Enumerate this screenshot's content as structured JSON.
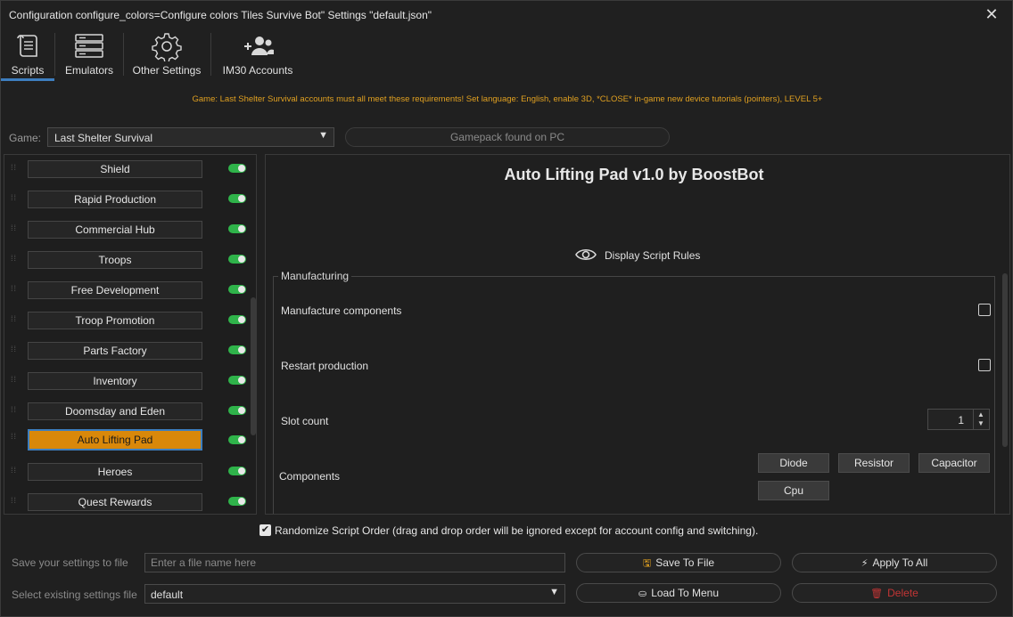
{
  "window": {
    "title": "Configuration configure_colors=Configure colors Tiles Survive Bot\" Settings \"default.json\"",
    "close_icon": "close-icon"
  },
  "tabs": [
    {
      "label": "Scripts",
      "icon": "scroll-icon",
      "active": true
    },
    {
      "label": "Emulators",
      "icon": "server-icon",
      "active": false
    },
    {
      "label": "Other Settings",
      "icon": "gear-icon",
      "active": false
    },
    {
      "label": "IM30 Accounts",
      "icon": "users-icon",
      "active": false
    }
  ],
  "requirements": "Game: Last Shelter Survival accounts must all meet these requirements! Set language: English, enable 3D, *CLOSE* in-game new device tutorials (pointers), LEVEL 5+",
  "game": {
    "label": "Game:",
    "selected": "Last Shelter Survival",
    "gamepack_status": "Gamepack found on PC"
  },
  "scripts": [
    {
      "label": "Shield",
      "enabled": true,
      "active": false
    },
    {
      "label": "Rapid Production",
      "enabled": true,
      "active": false
    },
    {
      "label": "Commercial Hub",
      "enabled": true,
      "active": false
    },
    {
      "label": "Troops",
      "enabled": true,
      "active": false
    },
    {
      "label": "Free Development",
      "enabled": true,
      "active": false
    },
    {
      "label": "Troop Promotion",
      "enabled": true,
      "active": false
    },
    {
      "label": "Parts Factory",
      "enabled": true,
      "active": false
    },
    {
      "label": "Inventory",
      "enabled": true,
      "active": false
    },
    {
      "label": "Doomsday and Eden",
      "enabled": true,
      "active": false
    },
    {
      "label": "Auto Lifting Pad",
      "enabled": true,
      "active": true
    },
    {
      "label": "Heroes",
      "enabled": true,
      "active": false
    },
    {
      "label": "Quest Rewards",
      "enabled": true,
      "active": false
    }
  ],
  "panel": {
    "title": "Auto Lifting Pad v1.0 by BoostBot",
    "rules_link": "Display Script Rules",
    "group_title": "Manufacturing",
    "options": {
      "manufacture_components": {
        "label": "Manufacture components",
        "checked": false
      },
      "restart_production": {
        "label": "Restart production",
        "checked": false
      },
      "slot_count": {
        "label": "Slot count",
        "value": "1"
      },
      "components": {
        "label": "Components",
        "items": [
          "Diode",
          "Resistor",
          "Capacitor",
          "Cpu"
        ]
      }
    }
  },
  "randomize": {
    "checked": true,
    "label": "Randomize Script Order (drag and drop order will be ignored except for account config and switching)."
  },
  "save": {
    "label": "Save your settings to file",
    "placeholder": "Enter a file name here",
    "save_button": "Save To File",
    "apply_button": "Apply To All"
  },
  "load": {
    "label": "Select existing settings file",
    "selected": "default",
    "load_button": "Load To Menu",
    "delete_button": "Delete"
  },
  "colors": {
    "accent": "#3d7ebf",
    "active_script": "#d9880a",
    "toggle_on": "#2fb34a",
    "warning_text": "#e0a020",
    "delete": "#c23535"
  }
}
